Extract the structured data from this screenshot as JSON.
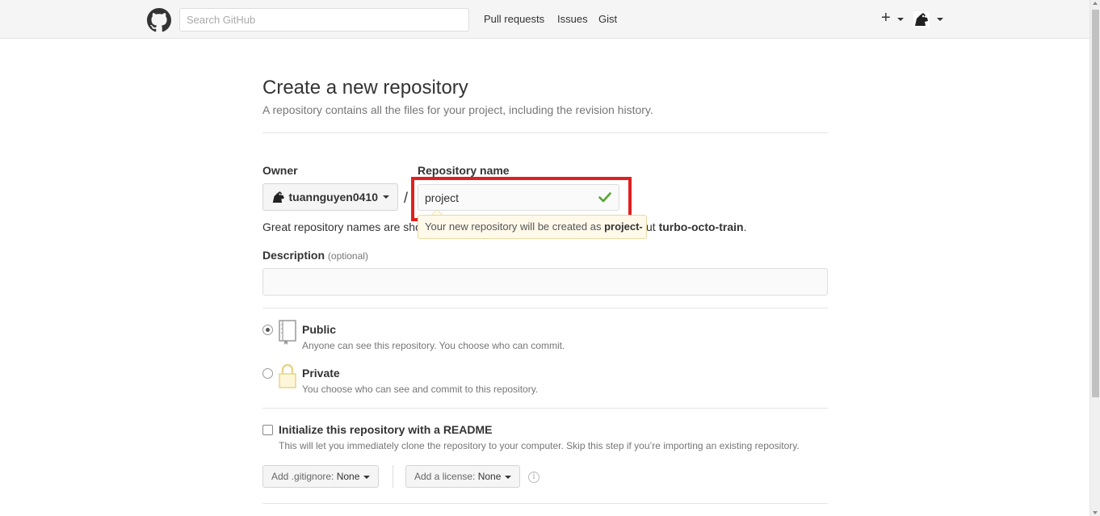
{
  "header": {
    "search_placeholder": "Search GitHub",
    "nav": {
      "pull_requests": "Pull requests",
      "issues": "Issues",
      "gist": "Gist"
    },
    "plus_label": "+",
    "icons": {
      "logo": "github-octocat-icon",
      "plus": "plus-icon",
      "avatar": "user-avatar"
    }
  },
  "page": {
    "title": "Create a new repository",
    "subtitle": "A repository contains all the files for your project, including the revision history."
  },
  "form": {
    "owner_label": "Owner",
    "owner_value": "tuannguyen0410",
    "slash": "/",
    "repo_label": "Repository name",
    "repo_value": "project",
    "hint_start": "Great repository names are sho",
    "hint_end_prefix": "ut ",
    "hint_suggestion": "turbo-octo-train",
    "hint_end_suffix": ".",
    "tooltip_prefix": "Your new repository will be created as ",
    "tooltip_value": "project-",
    "description_label": "Description",
    "description_optional": "(optional)",
    "description_value": "",
    "visibility": [
      {
        "title": "Public",
        "desc": "Anyone can see this repository. You choose who can commit.",
        "checked": true,
        "icon": "repo-book-icon"
      },
      {
        "title": "Private",
        "desc": "You choose who can see and commit to this repository.",
        "checked": false,
        "icon": "lock-icon"
      }
    ],
    "init_readme_label": "Initialize this repository with a README",
    "init_readme_desc": "This will let you immediately clone the repository to your computer. Skip this step if you’re importing an existing repository.",
    "init_readme_checked": false,
    "gitignore_label": "Add .gitignore: ",
    "gitignore_value": "None",
    "license_label": "Add a license: ",
    "license_value": "None",
    "info_glyph": "i"
  },
  "colors": {
    "highlight": "#e02020",
    "check": "#55a532",
    "tooltip_bg": "#fff9ea"
  }
}
